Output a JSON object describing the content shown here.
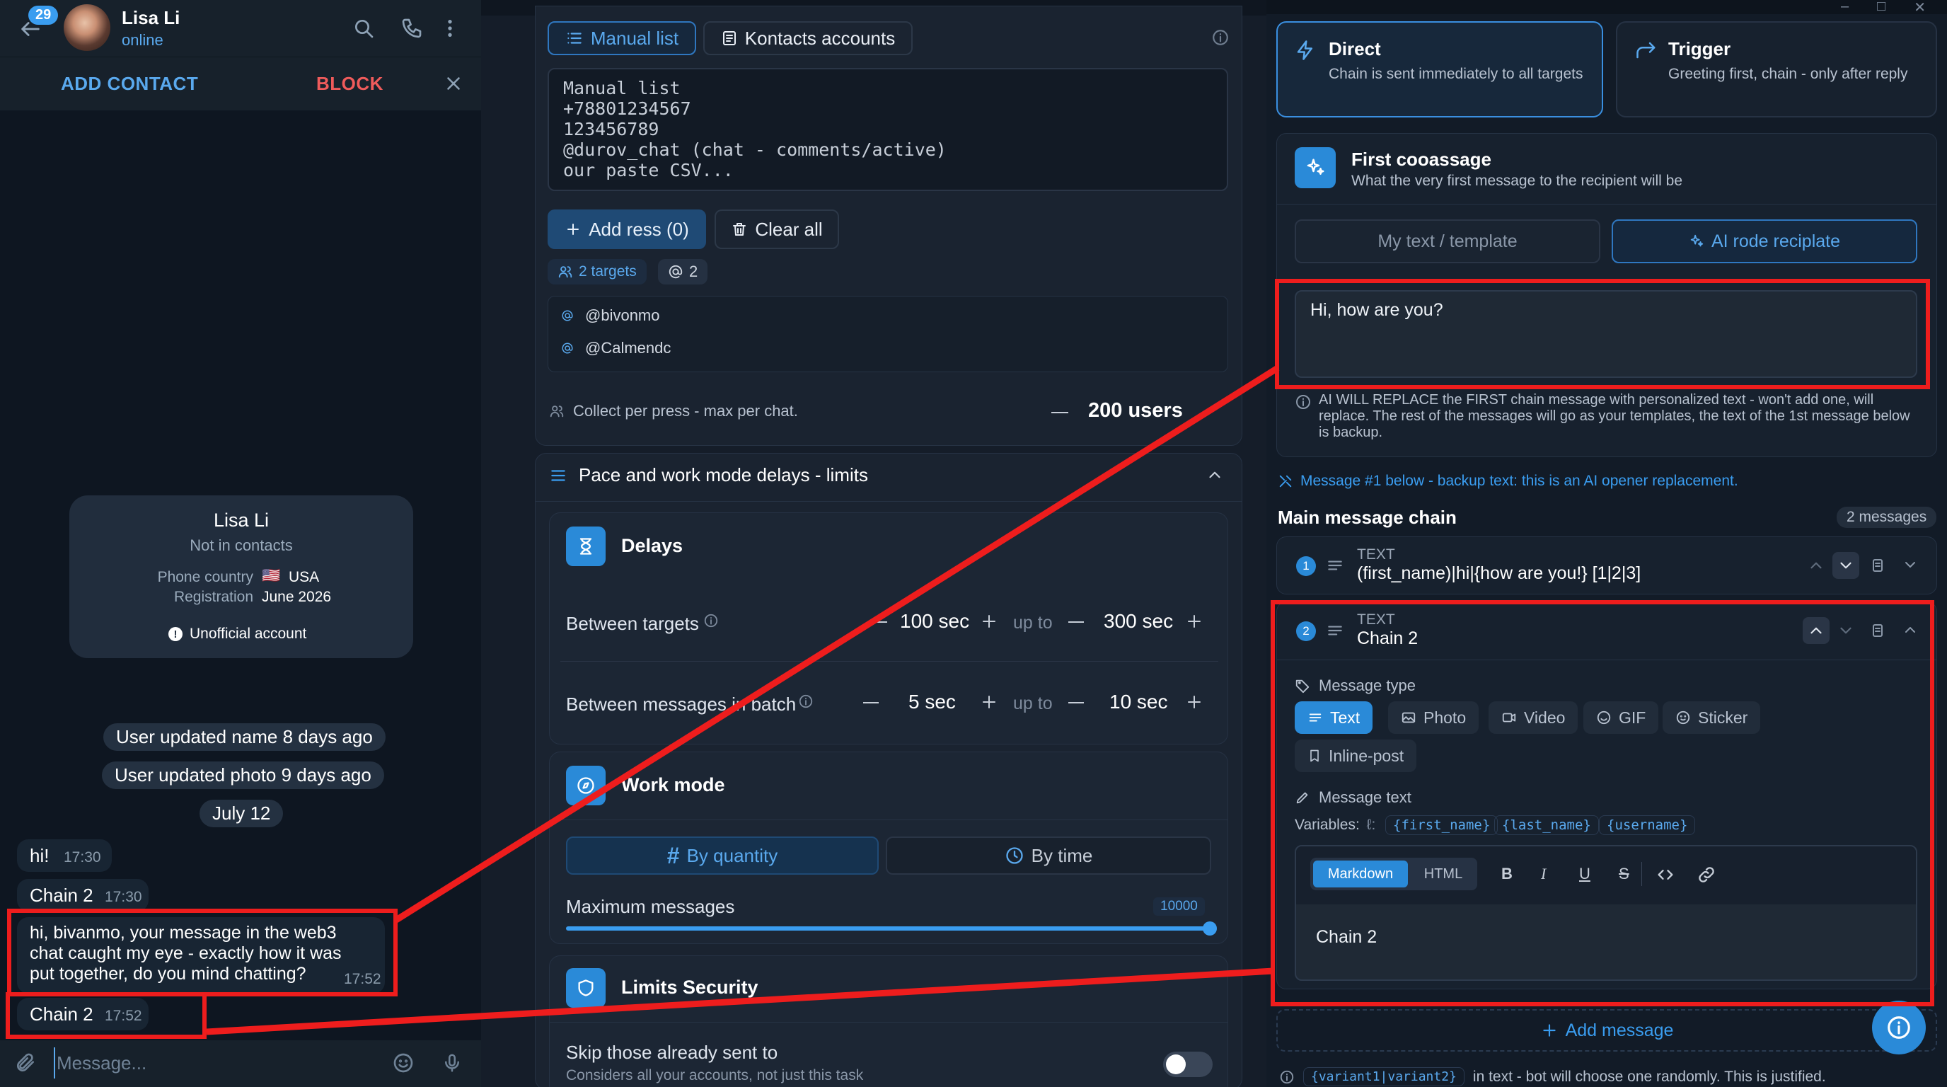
{
  "chat": {
    "unread_badge": "29",
    "contact_name": "Lisa Li",
    "status": "online",
    "add_contact": "ADD CONTACT",
    "block": "BLOCK",
    "info_card": {
      "name": "Lisa Li",
      "subtitle": "Not in contacts",
      "phone_country_label": "Phone country",
      "phone_country_flag": "🇺🇸",
      "phone_country_value": "USA",
      "registration_label": "Registration",
      "registration_value": "June 2026",
      "unofficial": "Unofficial account"
    },
    "service_messages": [
      "User updated name 8 days ago",
      "User updated photo 9 days ago",
      "July 12"
    ],
    "messages": [
      {
        "text": "hi!",
        "time": "17:30"
      },
      {
        "text": "Chain 2",
        "time": "17:30"
      },
      {
        "text": "hi, bivanmo, your message in the web3 chat caught my eye - exactly how it was put together, do you mind chatting?",
        "time": "17:52"
      },
      {
        "text": "Chain 2",
        "time": "17:52"
      }
    ],
    "compose_placeholder": "Message..."
  },
  "targets": {
    "tabs": [
      "Manual list",
      "Kontacts accounts"
    ],
    "textarea_value": "Manual list\n+78801234567\n123456789\n@durov_chat (chat - comments/active)\nour paste CSV...",
    "add_button": "Add ress (0)",
    "clear_button": "Clear all",
    "targets_badge": "2 targets",
    "count_badge": "2",
    "list": [
      "@bivonmo",
      "@Calmendc"
    ],
    "collect_label": "Collect per press - max per chat.",
    "collect_value": "200 users"
  },
  "pace": {
    "section_title": "Pace and work mode delays - limits",
    "delays_title": "Delays",
    "between_targets_label": "Between targets",
    "between_targets_min": "100 sec",
    "between_targets_max": "300 sec",
    "between_messages_label": "Between messages in batch",
    "between_messages_min": "5 sec",
    "between_messages_max": "10 sec",
    "up_to": "up to",
    "work_mode_title": "Work mode",
    "by_quantity": "By quantity",
    "by_time": "By time",
    "max_messages_label": "Maximum messages",
    "max_messages_value": "10000",
    "max_messages_fraction": 1.0,
    "limits_title": "Limits Security",
    "skip_label": "Skip those already sent to",
    "skip_sub": "Considers all your accounts, not just this task"
  },
  "mode": {
    "direct_title": "Direct",
    "direct_desc": "Chain is sent immediately to all targets",
    "trigger_title": "Trigger",
    "trigger_desc": "Greeting first, chain - only after reply",
    "first_title": "First cooassage",
    "first_desc": "What the very first message to the recipient will be",
    "opt_my_text": "My text / template",
    "opt_ai": "AI rode reciplate",
    "ai_text": "Hi, how are you?",
    "ai_note": "AI WILL REPLACE the FIRST chain message with personalized text - won't add one, will replace. The rest of the messages will go as your templates, the text of the 1st message below is backup.",
    "backup_note": "Message #1 below - backup text: this is an AI opener replacement."
  },
  "chain": {
    "title": "Main message chain",
    "count": "2 messages",
    "items": [
      {
        "num": "1",
        "type": "TEXT",
        "text": "(first_name)|hi|{how are you!} [1|2|3]"
      },
      {
        "num": "2",
        "type": "TEXT",
        "text": "Chain 2"
      }
    ],
    "message_type_label": "Message type",
    "types": [
      "Text",
      "Photo",
      "Video",
      "GIF",
      "Sticker",
      "Inline-post"
    ],
    "message_text_label": "Message text",
    "variables_label": "Variables:",
    "variables": [
      "{first_name}",
      "{last_name}",
      "{username}"
    ],
    "editor_tabs": [
      "Markdown",
      "HTML"
    ],
    "format_buttons": [
      "B",
      "I",
      "U",
      "S"
    ],
    "editor_text": "Chain 2",
    "add_message": "Add message",
    "footer_code": "{variant1|variant2}",
    "footer_text": "in text - bot will choose one randomly. This is justified."
  },
  "colors": {
    "accent": "#3a9df0",
    "annotation": "#ee1d1d",
    "bg": "#0f1721"
  }
}
